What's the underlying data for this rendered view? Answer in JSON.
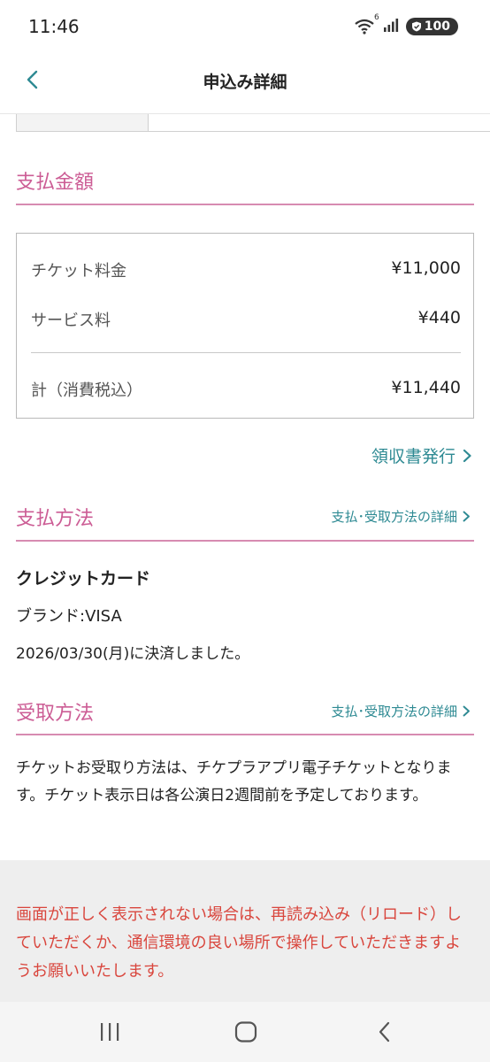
{
  "status_bar": {
    "time": "11:46",
    "wifi_badge": "6",
    "battery": "100"
  },
  "header": {
    "title": "申込み詳細"
  },
  "payment_amount": {
    "title": "支払金額",
    "rows": [
      {
        "label": "チケット料金",
        "value": "¥11,000"
      },
      {
        "label": "サービス料",
        "value": "¥440"
      }
    ],
    "total": {
      "label": "計（消費税込）",
      "value": "¥11,440"
    },
    "receipt_link": "領収書発行"
  },
  "payment_method": {
    "title": "支払方法",
    "detail_link": "支払･受取方法の詳細",
    "method": "クレジットカード",
    "brand": "ブランド:VISA",
    "settled": "2026/03/30(月)に決済しました。"
  },
  "receive_method": {
    "title": "受取方法",
    "detail_link": "支払･受取方法の詳細",
    "description": "チケットお受取り方法は、チケプラアプリ電子チケットとなります。チケット表示日は各公演日2週間前を予定しております。"
  },
  "notice": "画面が正しく表示されない場合は、再読み込み（リロード）していただくか、通信環境の良い場所で操作していただきますようお願いいたします。",
  "colors": {
    "accent_pink": "#cc5d95",
    "link_teal": "#2e8a93",
    "notice_red": "#d9463d"
  }
}
